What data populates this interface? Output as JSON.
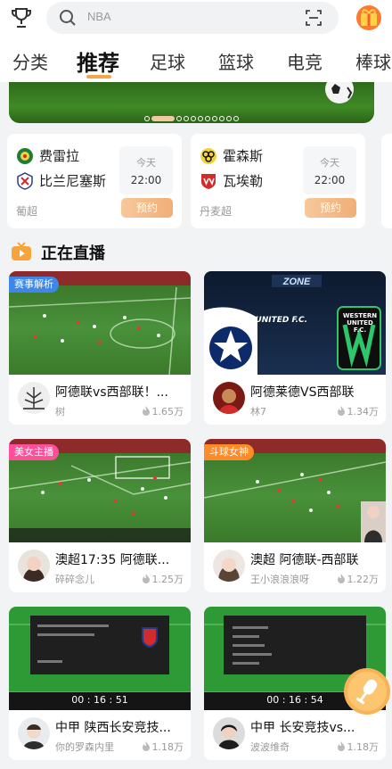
{
  "search": {
    "placeholder": "NBA"
  },
  "tabs": [
    "分类",
    "推荐",
    "足球",
    "篮球",
    "电竞",
    "棒球"
  ],
  "active_tab": "推荐",
  "matches": [
    {
      "home": "费雷拉",
      "away": "比兰尼塞斯",
      "day": "今天",
      "time": "22:00",
      "league": "葡超",
      "action": "预约"
    },
    {
      "home": "霍森斯",
      "away": "瓦埃勒",
      "day": "今天",
      "time": "22:00",
      "league": "丹麦超",
      "action": "预约"
    }
  ],
  "live_section": {
    "title": "正在直播"
  },
  "streams": [
    {
      "tag": "赛事解析",
      "title": "阿德联vs西部联！...",
      "author": "树",
      "views": "1.65万"
    },
    {
      "tag": "",
      "title": "阿德莱德VS西部联",
      "author": "林7",
      "views": "1.34万",
      "thumb_text_left": "ADELAIDE UNITED F.C.",
      "thumb_text_right": "WESTERN UNITED F.C."
    },
    {
      "tag": "美女主播",
      "title": "澳超17:35 阿德联...",
      "author": "碎碎念儿",
      "views": "1.25万"
    },
    {
      "tag": "斗球女神",
      "title": "澳超 阿德联-西部联",
      "author": "王小浪浪浪呀",
      "views": "1.22万"
    },
    {
      "tag": "",
      "title": "中甲 陕西长安竞技...",
      "author": "你的罗森内里",
      "views": "1.18万",
      "score": "00 : 16 : 51"
    },
    {
      "tag": "",
      "title": "中甲 长安竞技vs...",
      "author": "波波维奇",
      "views": "1.18万",
      "score": "00 : 16 : 54"
    }
  ],
  "colors": {
    "accent": "#f3a64a",
    "reserve": "#f1ae77",
    "tag_blue": "#3e86e8",
    "tag_pink": "#ff4f9a",
    "tag_orange": "#ff8a2a"
  }
}
